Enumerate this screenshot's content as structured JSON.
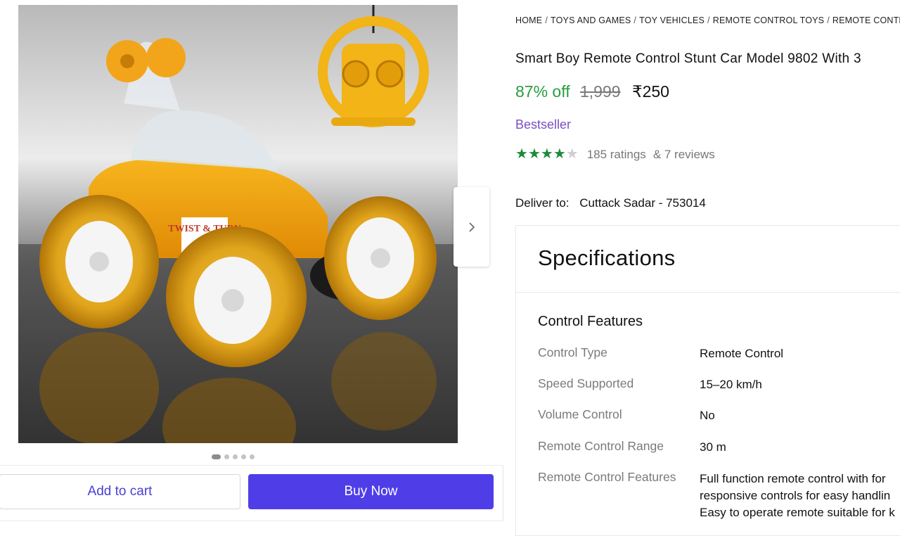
{
  "gallery": {
    "next_icon": "chevron-right-icon",
    "dot_count": 5,
    "active_dot": 0,
    "image_text": "TWIST & TURN"
  },
  "actions": {
    "add_to_cart": "Add to cart",
    "buy_now": "Buy Now"
  },
  "breadcrumb": [
    "HOME",
    "TOYS AND GAMES",
    "TOY VEHICLES",
    "REMOTE CONTROL TOYS",
    "REMOTE CONTR"
  ],
  "product": {
    "title": "Smart Boy Remote Control Stunt Car Model 9802 With 3",
    "discount": "87% off",
    "mrp": "1,999",
    "price": "₹250",
    "badge": "Bestseller",
    "rating_stars": 4,
    "rating_max": 5,
    "ratings_text": "185 ratings",
    "reviews_text": "& 7 reviews",
    "deliver_label": "Deliver to:",
    "deliver_location": "Cuttack Sadar - 753014"
  },
  "specifications": {
    "title": "Specifications",
    "section": "Control Features",
    "rows": [
      {
        "key": "Control Type",
        "value": "Remote Control"
      },
      {
        "key": "Speed Supported",
        "value": "15–20 km/h"
      },
      {
        "key": "Volume Control",
        "value": "No"
      },
      {
        "key": "Remote Control Range",
        "value": "30 m"
      },
      {
        "key": "Remote Control Features",
        "value_lines": [
          "Full function remote control with for",
          "responsive controls for easy handlin",
          "Easy to operate remote suitable for k"
        ]
      }
    ]
  },
  "colors": {
    "accent": "#4f3ee8",
    "discount": "#2a9d3f",
    "bestseller": "#7b4fc0",
    "star": "#1e8a3a"
  }
}
